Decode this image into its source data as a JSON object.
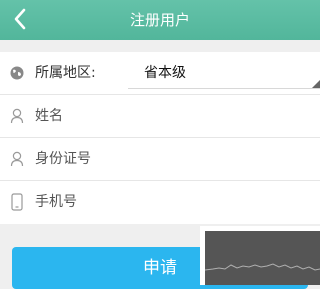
{
  "header": {
    "title": "注册用户",
    "back_icon": "chevron-left-icon"
  },
  "form": {
    "region": {
      "label": "所属地区:",
      "icon": "globe-icon",
      "value": "省本级"
    },
    "name": {
      "placeholder": "姓名",
      "icon": "user-icon"
    },
    "id_number": {
      "placeholder": "身份证号",
      "icon": "user-icon"
    },
    "phone": {
      "placeholder": "手机号",
      "icon": "mobile-phone-icon"
    }
  },
  "submit": {
    "label": "申请"
  },
  "colors": {
    "header": "#57b99e",
    "button": "#2bb6ef",
    "background": "#efefef"
  }
}
